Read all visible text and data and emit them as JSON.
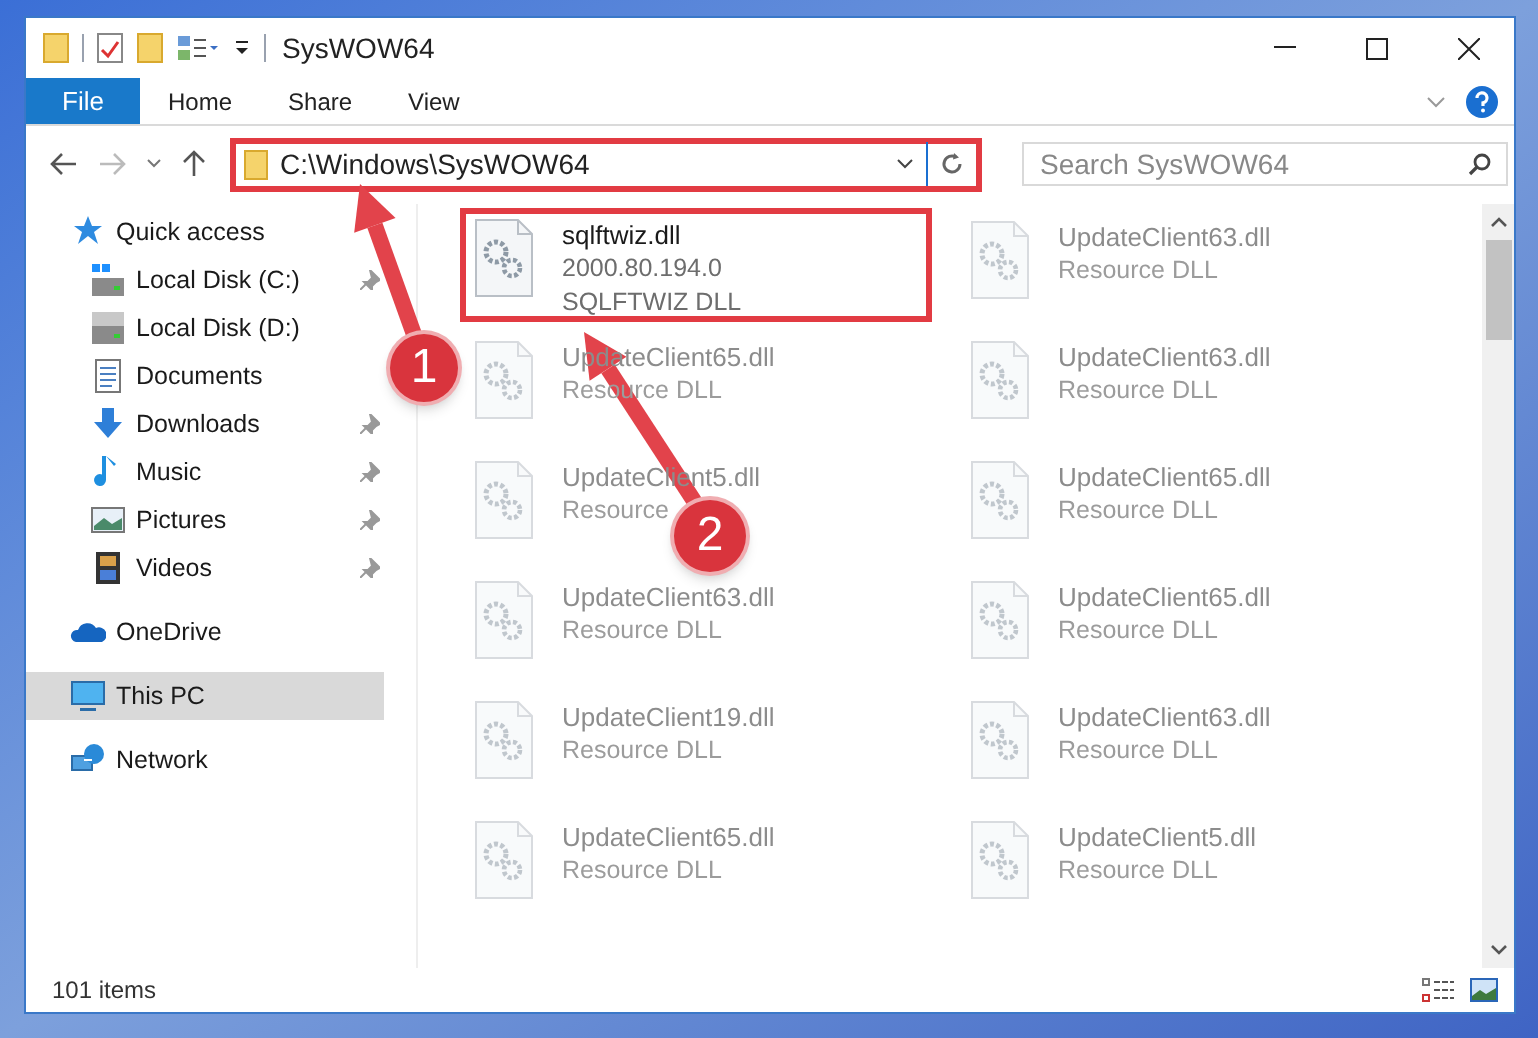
{
  "window": {
    "title": "SysWOW64"
  },
  "ribbon_tabs": [
    {
      "label": "File",
      "selected": true
    },
    {
      "label": "Home",
      "selected": false
    },
    {
      "label": "Share",
      "selected": false
    },
    {
      "label": "View",
      "selected": false
    }
  ],
  "address_bar": {
    "path": "C:\\Windows\\SysWOW64",
    "highlighted": true
  },
  "search": {
    "placeholder": "Search SysWOW64"
  },
  "sidebar": {
    "items": [
      {
        "label": "Quick access",
        "kind": "star",
        "selected": false,
        "children": [
          {
            "label": "Local Disk (C:)",
            "kind": "drive-c",
            "pinned": true,
            "selected": false
          },
          {
            "label": "Local Disk (D:)",
            "kind": "drive",
            "pinned": false,
            "selected": false
          },
          {
            "label": "Documents",
            "kind": "documents",
            "pinned": false,
            "selected": false
          },
          {
            "label": "Downloads",
            "kind": "downloads",
            "pinned": true,
            "selected": false
          },
          {
            "label": "Music",
            "kind": "music",
            "pinned": true,
            "selected": false
          },
          {
            "label": "Pictures",
            "kind": "pictures",
            "pinned": true,
            "selected": false
          },
          {
            "label": "Videos",
            "kind": "videos",
            "pinned": true,
            "selected": false
          }
        ]
      },
      {
        "label": "OneDrive",
        "kind": "cloud",
        "selected": false
      },
      {
        "label": "This PC",
        "kind": "pc",
        "selected": true
      },
      {
        "label": "Network",
        "kind": "network",
        "selected": false
      }
    ]
  },
  "files": [
    {
      "name": "sqlftwiz.dll",
      "lines": [
        "2000.80.194.0",
        "SQLFTWIZ DLL"
      ],
      "blurred": false,
      "highlighted": true
    },
    {
      "name": "UpdateClient63.dll",
      "lines": [
        "Resource DLL"
      ],
      "blurred": true,
      "highlighted": false
    },
    {
      "name": "UpdateClient65.dll",
      "lines": [
        "Resource DLL"
      ],
      "blurred": true,
      "highlighted": false
    },
    {
      "name": "UpdateClient63.dll",
      "lines": [
        "Resource DLL"
      ],
      "blurred": true,
      "highlighted": false
    },
    {
      "name": "UpdateClient5.dll",
      "lines": [
        "Resource"
      ],
      "blurred": true,
      "highlighted": false
    },
    {
      "name": "UpdateClient65.dll",
      "lines": [
        "Resource DLL"
      ],
      "blurred": true,
      "highlighted": false
    },
    {
      "name": "UpdateClient63.dll",
      "lines": [
        "Resource DLL"
      ],
      "blurred": true,
      "highlighted": false
    },
    {
      "name": "UpdateClient65.dll",
      "lines": [
        "Resource DLL"
      ],
      "blurred": true,
      "highlighted": false
    },
    {
      "name": "UpdateClient19.dll",
      "lines": [
        "Resource DLL"
      ],
      "blurred": true,
      "highlighted": false
    },
    {
      "name": "UpdateClient63.dll",
      "lines": [
        "Resource DLL"
      ],
      "blurred": true,
      "highlighted": false
    },
    {
      "name": "UpdateClient65.dll",
      "lines": [
        "Resource DLL"
      ],
      "blurred": true,
      "highlighted": false
    },
    {
      "name": "UpdateClient5.dll",
      "lines": [
        "Resource DLL"
      ],
      "blurred": true,
      "highlighted": false
    }
  ],
  "callouts": [
    {
      "number": "1"
    },
    {
      "number": "2"
    }
  ],
  "status_bar": {
    "item_count": "101 items"
  }
}
